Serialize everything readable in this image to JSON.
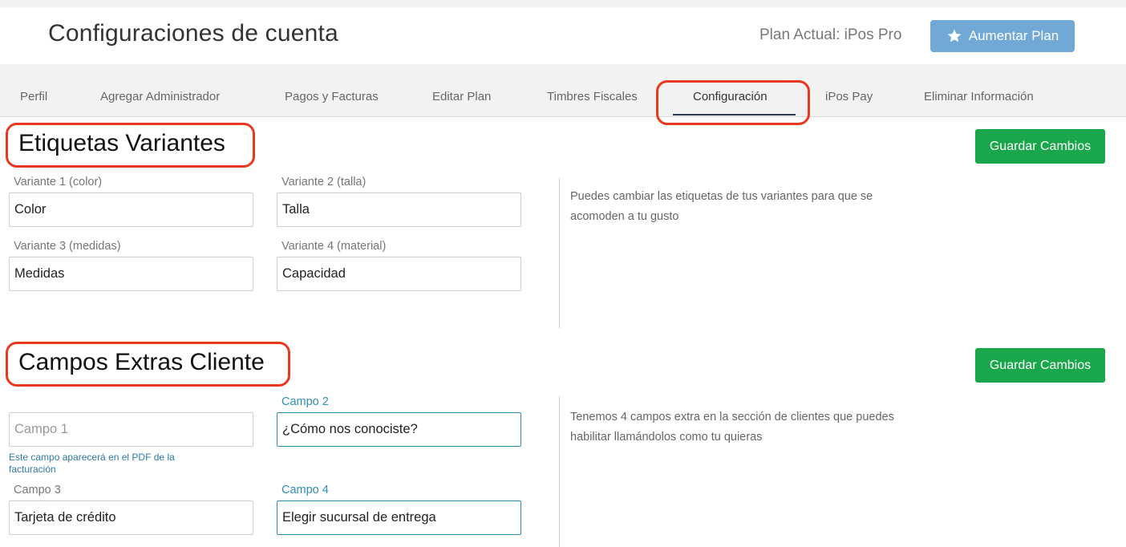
{
  "header": {
    "title": "Configuraciones de cuenta",
    "plan_label": "Plan Actual: iPos Pro",
    "upgrade_label": "Aumentar Plan"
  },
  "tabs": [
    {
      "label": "Perfil"
    },
    {
      "label": "Agregar Administrador"
    },
    {
      "label": "Pagos y Facturas"
    },
    {
      "label": "Editar Plan"
    },
    {
      "label": "Timbres Fiscales"
    },
    {
      "label": "Configuración",
      "active": true
    },
    {
      "label": "iPos Pay"
    },
    {
      "label": "Eliminar Información"
    }
  ],
  "variants": {
    "title": "Etiquetas Variantes",
    "save_label": "Guardar Cambios",
    "fields": [
      {
        "label": "Variante 1 (color)",
        "value": "Color"
      },
      {
        "label": "Variante 2 (talla)",
        "value": "Talla"
      },
      {
        "label": "Variante 3 (medidas)",
        "value": "Medidas"
      },
      {
        "label": "Variante 4 (material)",
        "value": "Capacidad"
      }
    ],
    "description": "Puedes cambiar las etiquetas de tus variantes para que se acomoden a tu gusto"
  },
  "client_fields": {
    "title": "Campos Extras Cliente",
    "save_label": "Guardar Cambios",
    "fields": [
      {
        "label": "",
        "value": "",
        "placeholder": "Campo 1"
      },
      {
        "label": "Campo 2",
        "value": "¿Cómo nos conociste?"
      },
      {
        "label": "Campo 3",
        "value": "Tarjeta de crédito"
      },
      {
        "label": "Campo 4",
        "value": "Elegir sucursal de entrega"
      }
    ],
    "pdf_note": "Este campo aparecerá en el PDF de la facturación",
    "description": "Tenemos 4 campos extra en la sección de clientes que puedes habilitar llamándolos como tu quieras"
  },
  "colors": {
    "accent_blue": "#72a8d6",
    "save_green": "#1aa64b",
    "highlight_red": "#e8391f"
  }
}
